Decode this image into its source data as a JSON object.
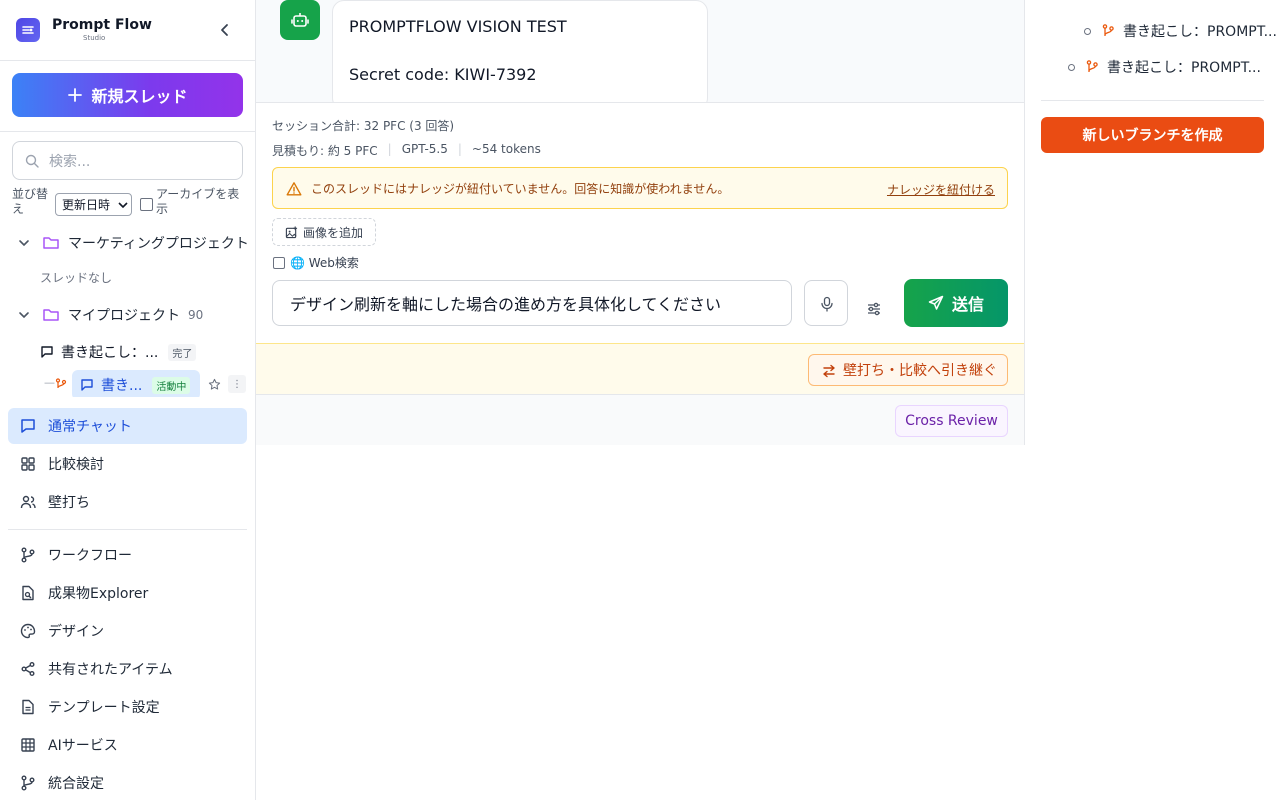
{
  "brand": {
    "name": "Prompt Flow",
    "sub": "Studio"
  },
  "sidebar": {
    "new_thread": "新規スレッド",
    "search_placeholder": "検索...",
    "sort_label": "並び替え",
    "sort_value": "更新日時",
    "archive_label": "アーカイブを表示",
    "projects": [
      {
        "name": "マーケティングプロジェクト",
        "count": "",
        "empty_text": "スレッドなし"
      },
      {
        "name": "マイプロジェクト",
        "count": "90"
      }
    ],
    "threads": [
      {
        "title": "書き起こし：...",
        "badge": "完了"
      },
      {
        "title": "書き...",
        "badge": "活動中"
      }
    ],
    "nav_main": [
      {
        "label": "通常チャット",
        "icon": "chat-icon",
        "active": true
      },
      {
        "label": "比較検討",
        "icon": "grid-icon"
      },
      {
        "label": "壁打ち",
        "icon": "users-icon"
      }
    ],
    "nav_tools": [
      {
        "label": "ワークフロー",
        "icon": "branch-icon"
      },
      {
        "label": "成果物Explorer",
        "icon": "file-search-icon"
      },
      {
        "label": "デザイン",
        "icon": "palette-icon"
      },
      {
        "label": "共有されたアイテム",
        "icon": "share-icon"
      },
      {
        "label": "テンプレート設定",
        "icon": "document-icon"
      },
      {
        "label": "AIサービス",
        "icon": "table-icon"
      },
      {
        "label": "統合設定",
        "icon": "branch-icon"
      }
    ]
  },
  "chat": {
    "message_line1": "PROMPTFLOW VISION TEST",
    "message_line2": "Secret code: KIWI-7392"
  },
  "composer": {
    "session_total": "セッション合計: 32 PFC (3 回答)",
    "estimate": "見積もり: 約 5 PFC",
    "model": "GPT-5.5",
    "tokens": "~54 tokens",
    "warning": "このスレッドにはナレッジが紐付いていません。回答に知識が使われません。",
    "warning_link": "ナレッジを紐付ける",
    "add_image": "画像を追加",
    "web_search": "🌐 Web検索",
    "input_value": "デザイン刷新を軸にした場合の進め方を具体化してください",
    "send": "送信",
    "handoff": "壁打ち・比較へ引き継ぐ",
    "cross_review": "Cross Review"
  },
  "branches": {
    "items": [
      {
        "label": "書き起こし：PROMPT..."
      },
      {
        "label": "書き起こし：PROMPT..."
      }
    ],
    "new_branch": "新しいブランチを作成"
  },
  "colors": {
    "accent_blue": "#3b82f6",
    "send_green": "#16a34a",
    "branch_orange": "#ea4c13"
  }
}
